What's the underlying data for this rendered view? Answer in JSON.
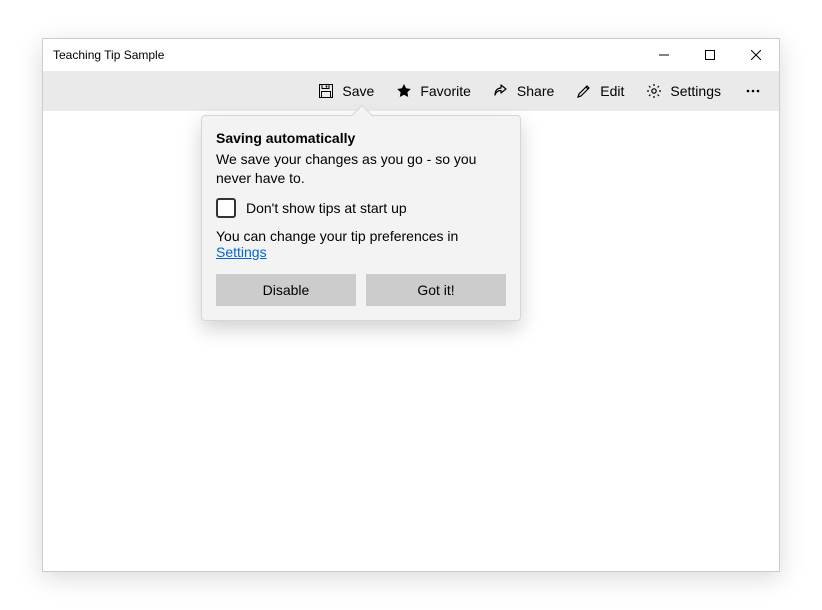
{
  "window": {
    "title": "Teaching Tip Sample"
  },
  "toolbar": {
    "save_label": "Save",
    "favorite_label": "Favorite",
    "share_label": "Share",
    "edit_label": "Edit",
    "settings_label": "Settings"
  },
  "tip": {
    "title": "Saving automatically",
    "subtitle": "We save your changes as you go - so you never have to.",
    "checkbox_label": "Don't show tips at start up",
    "footer_text_prefix": "You can change your tip preferences in ",
    "footer_link_label": "Settings",
    "disable_label": "Disable",
    "accept_label": "Got it!"
  }
}
